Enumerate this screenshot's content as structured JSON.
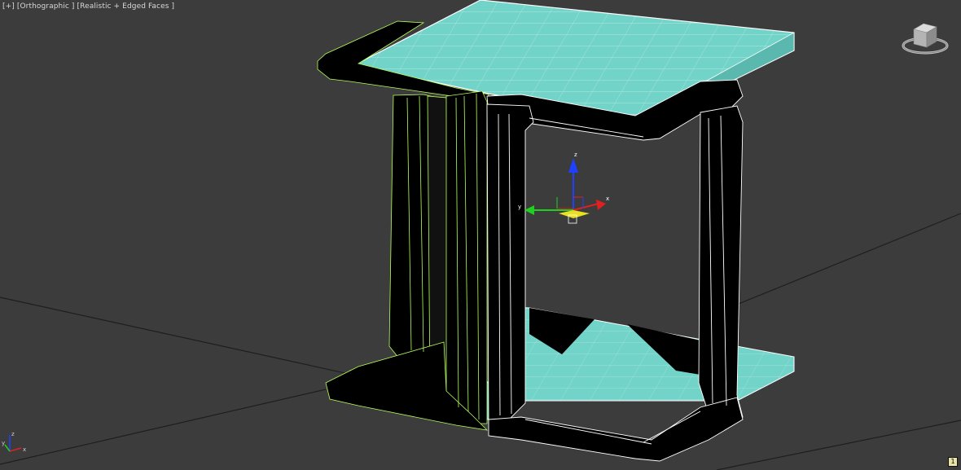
{
  "viewport": {
    "label_prefix": "[+]",
    "view_name": "[Orthographic ]",
    "shading_mode": "[Realistic + Edged Faces ]"
  },
  "gizmo": {
    "axis_x": "x",
    "axis_y": "y",
    "axis_z": "z"
  },
  "world_axis": {
    "axis_x": "x",
    "axis_y": "y",
    "axis_z": "z"
  },
  "status": {
    "page_indicator": "1"
  },
  "colors": {
    "background": "#3c3c3c",
    "grid_line": "#1e1e1e",
    "glass": "#72d3c8",
    "frame": "#000000",
    "edge_white": "#ffffff",
    "edge_selected": "#b8ff5a",
    "gizmo_x": "#e02020",
    "gizmo_y": "#20d020",
    "gizmo_z": "#2040ff"
  },
  "icons": [
    "viewcube-icon",
    "world-axis-icon",
    "transform-gizmo-icon"
  ]
}
